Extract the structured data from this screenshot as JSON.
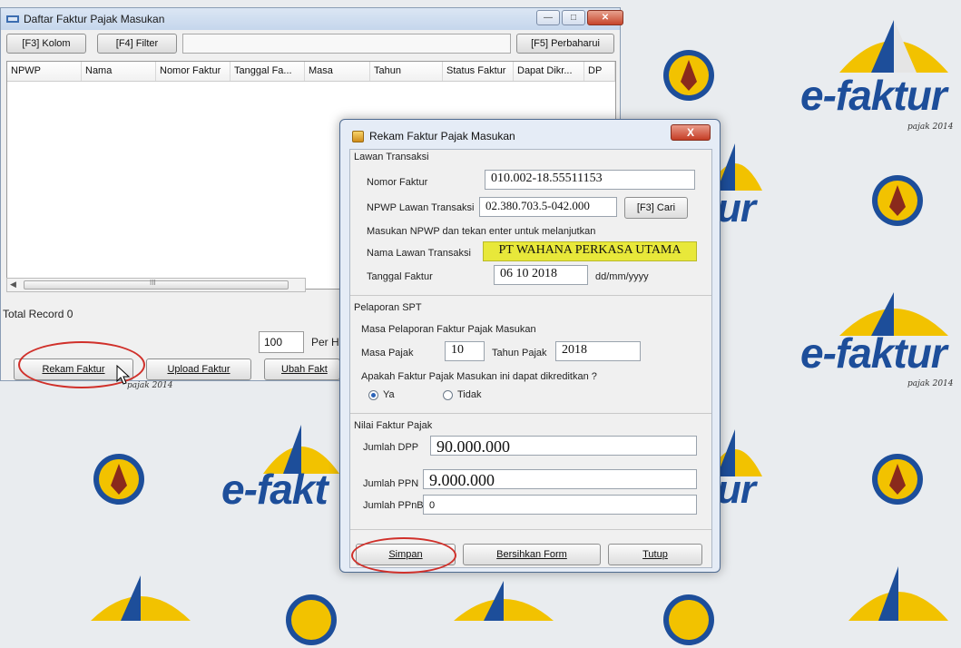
{
  "background": {
    "logo_text": "e-faktur",
    "logo_subtext": "pajak 2014",
    "brand_color": "#1d4e9a",
    "accent_yellow": "#f2c200"
  },
  "main_window": {
    "title": "Daftar Faktur Pajak Masukan",
    "toolbar": {
      "kolom_label": "[F3] Kolom",
      "filter_label": "[F4] Filter",
      "refresh_label": "[F5] Perbaharui"
    },
    "columns": [
      "NPWP",
      "Nama",
      "Nomor Faktur",
      "Tanggal Fa...",
      "Masa",
      "Tahun",
      "Status Faktur",
      "Dapat Dikr...",
      "DP"
    ],
    "scroll_marker": "III",
    "total_record": "Total Record 0",
    "per_page_value": "100",
    "per_page_label": "Per H",
    "buttons": {
      "rekam": "Rekam Faktur",
      "upload": "Upload Faktur",
      "ubah": "Ubah Fakt"
    },
    "watermark": "pajak 2014"
  },
  "dialog": {
    "title": "Rekam Faktur Pajak Masukan",
    "close_symbol": "X",
    "lawan": {
      "section": "Lawan Transaksi",
      "nomor_faktur_label": "Nomor Faktur",
      "nomor_faktur_value": "010.002-18.55511153",
      "npwp_label": "NPWP Lawan Transaksi",
      "npwp_value": "02.380.703.5-042.000",
      "cari_label": "[F3] Cari",
      "hint": "Masukan NPWP dan tekan enter untuk melanjutkan",
      "nama_label": "Nama Lawan Transaksi",
      "nama_value": "PT WAHANA PERKASA UTAMA",
      "tanggal_label": "Tanggal Faktur",
      "tanggal_value": "06 10 2018",
      "tanggal_format": "dd/mm/yyyy"
    },
    "pelaporan": {
      "section": "Pelaporan SPT",
      "masa_pelaporan_label": "Masa Pelaporan Faktur Pajak Masukan",
      "masa_pajak_label": "Masa Pajak",
      "masa_pajak_value": "10",
      "tahun_pajak_label": "Tahun Pajak",
      "tahun_pajak_value": "2018",
      "question": "Apakah Faktur Pajak Masukan ini dapat dikreditkan ?",
      "option_ya": "Ya",
      "option_tidak": "Tidak",
      "selected": "Ya"
    },
    "nilai": {
      "section": "Nilai Faktur Pajak",
      "dpp_label": "Jumlah DPP",
      "dpp_value": "90.000.000",
      "ppn_label": "Jumlah PPN",
      "ppn_value": "9.000.000",
      "ppnbm_label": "Jumlah PPnBM",
      "ppnbm_value": "0"
    },
    "buttons": {
      "simpan": "Simpan",
      "bersihkan": "Bersihkan Form",
      "tutup": "Tutup"
    }
  }
}
